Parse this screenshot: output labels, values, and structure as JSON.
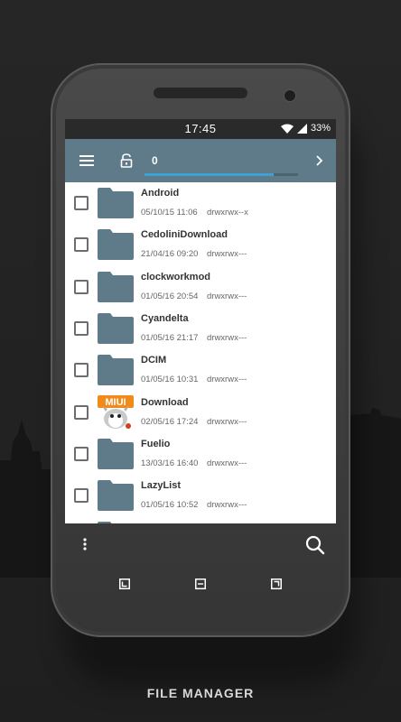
{
  "status_bar": {
    "time": "17:45",
    "battery": "33%"
  },
  "toolbar": {
    "count": "0",
    "progress_fraction": 0.84,
    "icons": [
      "menu-icon",
      "unlock-icon",
      "chevron-right-icon"
    ],
    "accent_color": "#5f7b89",
    "progress_color": "#3ea1d6"
  },
  "files": [
    {
      "name": "Android",
      "date": "05/10/15 11:06",
      "perm": "drwxrwx--x",
      "icon": "folder-icon"
    },
    {
      "name": "CedoliniDownload",
      "date": "21/04/16 09:20",
      "perm": "drwxrwx---",
      "icon": "folder-icon"
    },
    {
      "name": "clockworkmod",
      "date": "01/05/16 20:54",
      "perm": "drwxrwx---",
      "icon": "folder-icon"
    },
    {
      "name": "Cyandelta",
      "date": "01/05/16 21:17",
      "perm": "drwxrwx---",
      "icon": "folder-icon"
    },
    {
      "name": "DCIM",
      "date": "01/05/16 10:31",
      "perm": "drwxrwx---",
      "icon": "folder-icon"
    },
    {
      "name": "Download",
      "date": "02/05/16 17:24",
      "perm": "drwxrwx---",
      "icon": "miui-thumbnail"
    },
    {
      "name": "Fuelio",
      "date": "13/03/16 16:40",
      "perm": "drwxrwx---",
      "icon": "folder-icon"
    },
    {
      "name": "LazyList",
      "date": "01/05/16 10:52",
      "perm": "drwxrwx---",
      "icon": "folder-icon"
    }
  ],
  "thumbnail_text": "MIUI",
  "bottom_bar": {
    "icons": [
      "more-vert-icon",
      "search-icon"
    ]
  },
  "nav_bar": {
    "icons": [
      "back-icon",
      "home-icon",
      "recents-icon"
    ]
  },
  "caption": "FILE MANAGER"
}
